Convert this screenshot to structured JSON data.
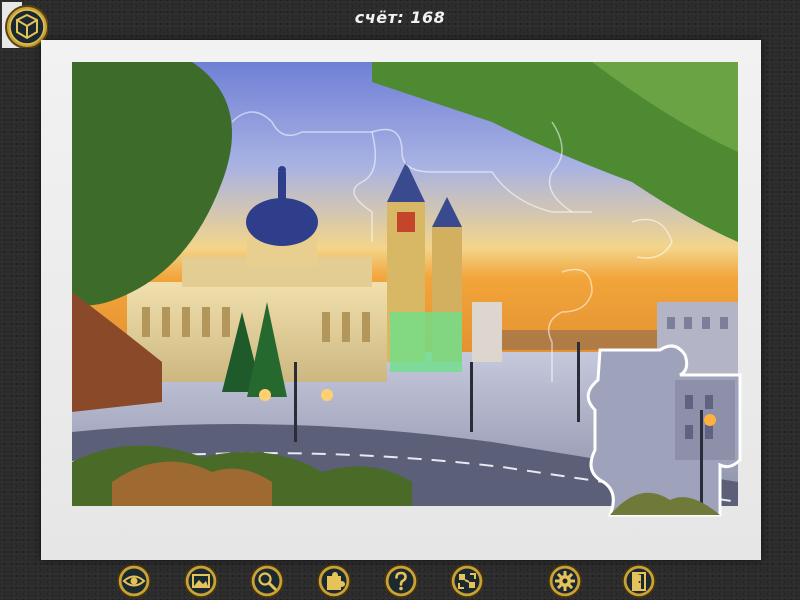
{
  "header": {
    "score_label": "счёт:",
    "score_value": "168"
  },
  "colors": {
    "board": "#efefef",
    "button_gold": "#c9a23a",
    "button_dark": "#1c2a30",
    "background": "#2b2b2b"
  },
  "menu": {
    "icon": "puzzle-box-icon"
  },
  "toolbar": {
    "buttons": [
      {
        "name": "eye-icon"
      },
      {
        "name": "picture-icon"
      },
      {
        "name": "magnifier-icon"
      },
      {
        "name": "puzzle-piece-icon"
      },
      {
        "name": "question-icon"
      },
      {
        "name": "pieces-sort-icon"
      },
      {
        "name": "settings-gear-icon"
      },
      {
        "name": "exit-door-icon"
      }
    ]
  }
}
